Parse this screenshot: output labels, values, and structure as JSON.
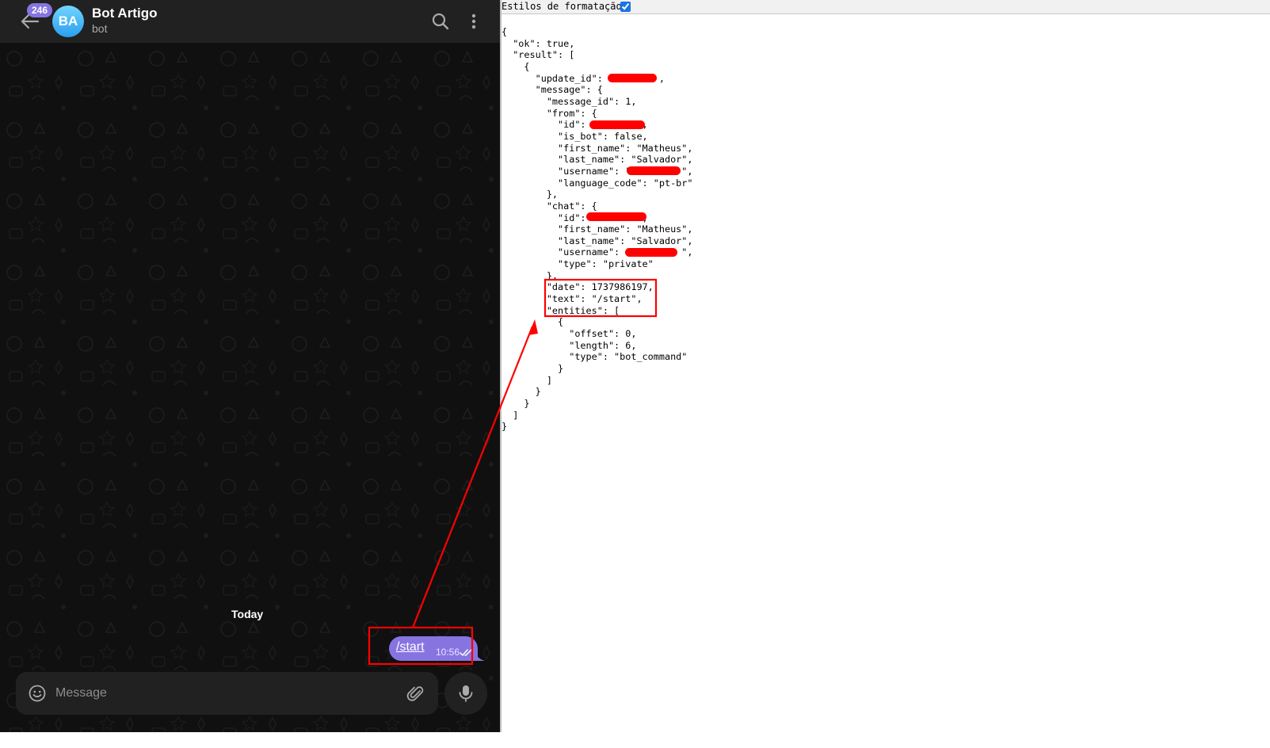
{
  "telegram": {
    "header": {
      "unread_count": "246",
      "avatar_initials": "BA",
      "title": "Bot Artigo",
      "subtitle": "bot",
      "icons": [
        "back-arrow-icon",
        "search-icon",
        "more-vertical-icon"
      ]
    },
    "date_separator": "Today",
    "message": {
      "text": "/start",
      "time": "10:56",
      "status_icon": "double-check-icon"
    },
    "composer": {
      "placeholder": "Message",
      "icons": [
        "emoji-icon",
        "paperclip-icon",
        "microphone-icon"
      ]
    },
    "colors": {
      "accent": "#8774e1",
      "panel": "#212121",
      "background": "#101010"
    }
  },
  "json_viewer": {
    "format_label": "Estilos de formatação",
    "format_checked": true,
    "lines": [
      "{",
      "  \"ok\": true,",
      "  \"result\": [",
      "    {",
      "      \"update_id\":          ,",
      "      \"message\": {",
      "        \"message_id\": 1,",
      "        \"from\": {",
      "          \"id\":          ,",
      "          \"is_bot\": false,",
      "          \"first_name\": \"Matheus\",",
      "          \"last_name\": \"Salvador\",",
      "          \"username\": \"         \",",
      "          \"language_code\": \"pt-br\"",
      "        },",
      "        \"chat\": {",
      "          \"id\":          ,",
      "          \"first_name\": \"Matheus\",",
      "          \"last_name\": \"Salvador\",",
      "          \"username\": \"         \",",
      "          \"type\": \"private\"",
      "        },",
      "        \"date\": 1737986197,",
      "        \"text\": \"/start\",",
      "        \"entities\": [",
      "          {",
      "            \"offset\": 0,",
      "            \"length\": 6,",
      "            \"type\": \"bot_command\"",
      "          }",
      "        ]",
      "      }",
      "    }",
      "  ]",
      "}"
    ]
  },
  "annotation": {
    "highlight_color": "#ff0000"
  }
}
